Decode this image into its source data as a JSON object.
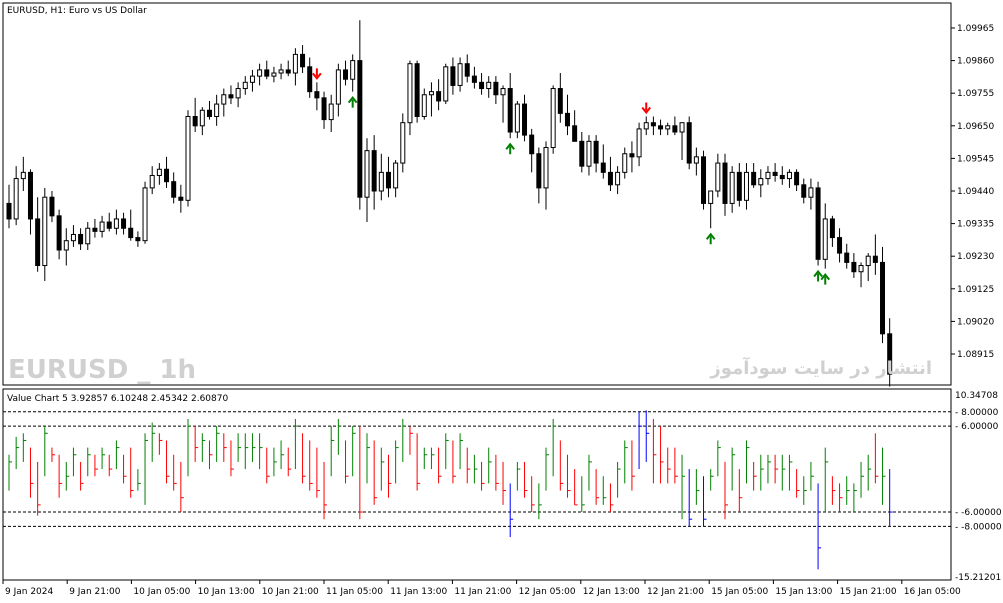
{
  "window": {
    "title": "EURUSD, H1:  Euro vs US Dollar",
    "watermark_left": "EURUSD _ 1h",
    "watermark_right": "انتشار در سایت سودآموز"
  },
  "indicator": {
    "title": "Value Chart 5 3.92857 6.10248 2.45342 2.60870",
    "levels": [
      8,
      6,
      -6,
      -8
    ],
    "level_labels": [
      "8.00000",
      "6.00000",
      "-6.00000",
      "-8.00000"
    ],
    "top_label": "10.34708",
    "bottom_label": "-15.21201",
    "colors": {
      "up": "#008000",
      "down": "#ff0000",
      "extreme": "#0000ff"
    }
  },
  "chart_data": {
    "type": "candlestick",
    "price_axis_labels": [
      "1.09965",
      "1.09860",
      "1.09755",
      "1.09650",
      "1.09545",
      "1.09440",
      "1.09335",
      "1.09230",
      "1.09125",
      "1.09020",
      "1.08915"
    ],
    "x_labels": [
      "9 Jan 2024",
      "9 Jan 21:00",
      "10 Jan 05:00",
      "10 Jan 13:00",
      "10 Jan 21:00",
      "11 Jan 05:00",
      "11 Jan 13:00",
      "11 Jan 21:00",
      "12 Jan 05:00",
      "12 Jan 13:00",
      "12 Jan 21:00",
      "15 Jan 05:00",
      "15 Jan 13:00",
      "15 Jan 21:00",
      "16 Jan 05:00"
    ],
    "ohlc": [
      [
        1.094,
        1.0946,
        1.0932,
        1.0935
      ],
      [
        1.0935,
        1.0952,
        1.0933,
        1.0948
      ],
      [
        1.0948,
        1.0955,
        1.0944,
        1.095
      ],
      [
        1.095,
        1.0951,
        1.093,
        1.0935
      ],
      [
        1.0935,
        1.0942,
        1.0918,
        1.092
      ],
      [
        1.092,
        1.0945,
        1.0915,
        1.0942
      ],
      [
        1.0942,
        1.0944,
        1.0934,
        1.0936
      ],
      [
        1.0936,
        1.0938,
        1.0922,
        1.0925
      ],
      [
        1.0925,
        1.0932,
        1.092,
        1.0928
      ],
      [
        1.0928,
        1.0933,
        1.0926,
        1.093
      ],
      [
        1.093,
        1.0932,
        1.0925,
        1.0927
      ],
      [
        1.0927,
        1.0934,
        1.0925,
        1.0932
      ],
      [
        1.0932,
        1.0935,
        1.0929,
        1.0931
      ],
      [
        1.0931,
        1.0936,
        1.0929,
        1.0934
      ],
      [
        1.0934,
        1.0937,
        1.0931,
        1.0932
      ],
      [
        1.0932,
        1.0938,
        1.093,
        1.0935
      ],
      [
        1.0935,
        1.0937,
        1.093,
        1.0932
      ],
      [
        1.0932,
        1.0938,
        1.0928,
        1.0929
      ],
      [
        1.0929,
        1.0931,
        1.0926,
        1.0928
      ],
      [
        1.0928,
        1.0947,
        1.0927,
        1.0945
      ],
      [
        1.0945,
        1.0952,
        1.0943,
        1.0949
      ],
      [
        1.0949,
        1.0953,
        1.0946,
        1.0951
      ],
      [
        1.0951,
        1.0955,
        1.0945,
        1.0947
      ],
      [
        1.0947,
        1.095,
        1.094,
        1.0942
      ],
      [
        1.0942,
        1.0946,
        1.0937,
        1.0941
      ],
      [
        1.0941,
        1.097,
        1.0939,
        1.0968
      ],
      [
        1.0968,
        1.0974,
        1.0963,
        1.0965
      ],
      [
        1.0965,
        1.0971,
        1.0962,
        1.097
      ],
      [
        1.097,
        1.0973,
        1.0967,
        1.0968
      ],
      [
        1.0968,
        1.0975,
        1.0965,
        1.0972
      ],
      [
        1.0972,
        1.0977,
        1.0968,
        1.0975
      ],
      [
        1.0975,
        1.0978,
        1.0972,
        1.0974
      ],
      [
        1.0974,
        1.0979,
        1.0971,
        1.0977
      ],
      [
        1.0977,
        1.0981,
        1.0975,
        1.0979
      ],
      [
        1.0979,
        1.0983,
        1.0976,
        1.0981
      ],
      [
        1.0981,
        1.0985,
        1.0978,
        1.0983
      ],
      [
        1.0983,
        1.0986,
        1.098,
        1.0981
      ],
      [
        1.0981,
        1.0984,
        1.0979,
        1.0982
      ],
      [
        1.0982,
        1.0985,
        1.098,
        1.0983
      ],
      [
        1.0983,
        1.0986,
        1.0981,
        1.0982
      ],
      [
        1.0982,
        1.099,
        1.0978,
        1.0988
      ],
      [
        1.0988,
        1.0991,
        1.0982,
        1.0984
      ],
      [
        1.0984,
        1.0987,
        1.0974,
        1.0976
      ],
      [
        1.0976,
        1.0979,
        1.097,
        1.0974
      ],
      [
        1.0974,
        1.0976,
        1.0964,
        1.0967
      ],
      [
        1.0967,
        1.0975,
        1.0963,
        1.0972
      ],
      [
        1.0972,
        1.0985,
        1.0968,
        1.0983
      ],
      [
        1.0983,
        1.0986,
        1.0978,
        1.098
      ],
      [
        1.098,
        1.0988,
        1.0976,
        1.0986
      ],
      [
        1.0986,
        1.0999,
        1.0938,
        1.0942
      ],
      [
        1.0942,
        1.0961,
        1.0934,
        1.0957
      ],
      [
        1.0957,
        1.0962,
        1.0938,
        1.0944
      ],
      [
        1.0944,
        1.0956,
        1.0941,
        1.095
      ],
      [
        1.095,
        1.0955,
        1.0942,
        1.0945
      ],
      [
        1.0945,
        1.0954,
        1.0942,
        1.0953
      ],
      [
        1.0953,
        1.0969,
        1.095,
        1.0966
      ],
      [
        1.0966,
        1.0986,
        1.0962,
        1.0985
      ],
      [
        1.0985,
        1.0986,
        1.0966,
        1.0968
      ],
      [
        1.0968,
        1.0977,
        1.0967,
        1.0975
      ],
      [
        1.0975,
        1.0979,
        1.0968,
        1.0976
      ],
      [
        1.0976,
        1.098,
        1.097,
        1.0973
      ],
      [
        1.0973,
        1.0985,
        1.0972,
        1.0984
      ],
      [
        1.0984,
        1.0987,
        1.0975,
        1.0978
      ],
      [
        1.0978,
        1.0987,
        1.0976,
        1.0985
      ],
      [
        1.0985,
        1.0988,
        1.0979,
        1.0981
      ],
      [
        1.0981,
        1.0984,
        1.0977,
        1.0979
      ],
      [
        1.0979,
        1.0982,
        1.0975,
        1.0977
      ],
      [
        1.0977,
        1.0981,
        1.0974,
        1.0979
      ],
      [
        1.0979,
        1.0981,
        1.0972,
        1.0975
      ],
      [
        1.0975,
        1.0978,
        1.0966,
        1.0977
      ],
      [
        1.0977,
        1.0982,
        1.0961,
        1.0963
      ],
      [
        1.0963,
        1.0973,
        1.0961,
        1.0972
      ],
      [
        1.0972,
        1.0975,
        1.096,
        1.0962
      ],
      [
        1.0962,
        1.0964,
        1.095,
        1.0956
      ],
      [
        1.0956,
        1.0958,
        1.094,
        1.0945
      ],
      [
        1.0945,
        1.096,
        1.0938,
        1.0958
      ],
      [
        1.0958,
        1.0978,
        1.0956,
        1.0977
      ],
      [
        1.0977,
        1.0982,
        1.0966,
        1.0969
      ],
      [
        1.0969,
        1.0975,
        1.0962,
        1.0965
      ],
      [
        1.0965,
        1.097,
        1.096,
        1.096
      ],
      [
        1.096,
        1.0963,
        1.095,
        1.0952
      ],
      [
        1.0952,
        1.0962,
        1.0949,
        1.096
      ],
      [
        1.096,
        1.0962,
        1.095,
        1.0953
      ],
      [
        1.0953,
        1.0959,
        1.0948,
        1.095
      ],
      [
        1.095,
        1.0955,
        1.0944,
        1.0946
      ],
      [
        1.0946,
        1.0952,
        1.0943,
        1.095
      ],
      [
        1.095,
        1.0958,
        1.0948,
        1.0956
      ],
      [
        1.0956,
        1.096,
        1.095,
        1.0955
      ],
      [
        1.0955,
        1.0966,
        1.0952,
        1.0964
      ],
      [
        1.0964,
        1.0968,
        1.0962,
        1.0966
      ],
      [
        1.0966,
        1.0968,
        1.0962,
        1.0965
      ],
      [
        1.0965,
        1.0967,
        1.0962,
        1.0964
      ],
      [
        1.0964,
        1.0966,
        1.0962,
        1.0965
      ],
      [
        1.0965,
        1.0968,
        1.0962,
        1.0963
      ],
      [
        1.0963,
        1.0966,
        1.0954,
        1.0966
      ],
      [
        1.0966,
        1.0968,
        1.0951,
        1.0953
      ],
      [
        1.0953,
        1.0958,
        1.0949,
        1.0955
      ],
      [
        1.0955,
        1.0957,
        1.0938,
        1.094
      ],
      [
        1.094,
        1.0944,
        1.0932,
        1.0944
      ],
      [
        1.0944,
        1.0956,
        1.0942,
        1.0953
      ],
      [
        1.0953,
        1.0956,
        1.0936,
        1.094
      ],
      [
        1.094,
        1.0952,
        1.0937,
        1.095
      ],
      [
        1.095,
        1.0953,
        1.0939,
        1.0941
      ],
      [
        1.0941,
        1.0953,
        1.0938,
        1.095
      ],
      [
        1.095,
        1.0953,
        1.0945,
        1.0946
      ],
      [
        1.0946,
        1.0951,
        1.0942,
        1.0948
      ],
      [
        1.0948,
        1.0952,
        1.0946,
        1.095
      ],
      [
        1.095,
        1.0953,
        1.0947,
        1.0949
      ],
      [
        1.0949,
        1.0952,
        1.0946,
        1.0948
      ],
      [
        1.0948,
        1.0951,
        1.0945,
        1.095
      ],
      [
        1.095,
        1.0951,
        1.0944,
        1.0946
      ],
      [
        1.0946,
        1.0948,
        1.094,
        1.0942
      ],
      [
        1.0942,
        1.0948,
        1.0938,
        1.0945
      ],
      [
        1.0945,
        1.0947,
        1.092,
        1.0922
      ],
      [
        1.0922,
        1.094,
        1.0919,
        1.0935
      ],
      [
        1.0935,
        1.0936,
        1.0926,
        1.0929
      ],
      [
        1.0929,
        1.0932,
        1.0921,
        1.0924
      ],
      [
        1.0924,
        1.0927,
        1.0919,
        1.0921
      ],
      [
        1.0921,
        1.0924,
        1.0916,
        1.0918
      ],
      [
        1.0918,
        1.0921,
        1.0913,
        1.092
      ],
      [
        1.092,
        1.0924,
        1.0915,
        1.0923
      ],
      [
        1.0923,
        1.093,
        1.0917,
        1.0921
      ],
      [
        1.0921,
        1.0926,
        1.0895,
        1.0898
      ],
      [
        1.0898,
        1.0903,
        1.0881,
        1.0885
      ]
    ],
    "value_chart": [
      [
        -3,
        2,
        1
      ],
      [
        0,
        4.5,
        3
      ],
      [
        1,
        5,
        4
      ],
      [
        -4,
        3,
        -2
      ],
      [
        -6.5,
        1,
        -5
      ],
      [
        -1,
        6,
        5
      ],
      [
        1,
        3,
        2
      ],
      [
        -4,
        2,
        -2
      ],
      [
        -3,
        1,
        -1
      ],
      [
        -1,
        3,
        2
      ],
      [
        -3,
        1,
        -2
      ],
      [
        -1,
        3,
        2
      ],
      [
        -1,
        2,
        0
      ],
      [
        0,
        3,
        2
      ],
      [
        -1,
        2,
        0
      ],
      [
        0,
        4,
        3
      ],
      [
        -2,
        2,
        -1
      ],
      [
        -4,
        3,
        -3
      ],
      [
        -3,
        0,
        -2
      ],
      [
        -5,
        5,
        4
      ],
      [
        1,
        6.5,
        5
      ],
      [
        2,
        5,
        4
      ],
      [
        -2,
        4,
        -1
      ],
      [
        -3,
        2,
        -2
      ],
      [
        -6,
        1,
        -4
      ],
      [
        -1,
        7,
        6
      ],
      [
        1,
        6,
        3
      ],
      [
        1,
        5,
        4
      ],
      [
        0,
        4,
        2
      ],
      [
        1,
        6,
        5
      ],
      [
        1,
        5,
        3
      ],
      [
        -1,
        4,
        0
      ],
      [
        1,
        5,
        3
      ],
      [
        0,
        5,
        3
      ],
      [
        1,
        5,
        3
      ],
      [
        0,
        5,
        3
      ],
      [
        -2,
        3,
        -1
      ],
      [
        -1,
        3,
        1
      ],
      [
        0,
        4,
        2
      ],
      [
        -1,
        3,
        0
      ],
      [
        0,
        7,
        6
      ],
      [
        -2,
        5,
        -1
      ],
      [
        -3,
        4,
        -2
      ],
      [
        -4,
        3,
        -3
      ],
      [
        -7,
        1,
        -5
      ],
      [
        -1,
        6,
        4
      ],
      [
        2,
        7,
        6
      ],
      [
        -2,
        4,
        -1
      ],
      [
        -1,
        6,
        5
      ],
      [
        -7,
        6,
        -6
      ],
      [
        -2,
        5,
        3
      ],
      [
        -5,
        4,
        -4
      ],
      [
        -3,
        3,
        1
      ],
      [
        -4,
        2,
        -2
      ],
      [
        -2,
        4,
        3
      ],
      [
        1,
        7,
        6
      ],
      [
        2,
        6,
        5
      ],
      [
        -3,
        5,
        -2
      ],
      [
        0,
        3,
        2
      ],
      [
        0,
        3,
        2
      ],
      [
        -2,
        3,
        -1
      ],
      [
        0,
        5,
        4
      ],
      [
        -2,
        4,
        -1
      ],
      [
        0,
        5,
        4
      ],
      [
        -2,
        3,
        0
      ],
      [
        -2,
        2,
        0
      ],
      [
        -3,
        1,
        -2
      ],
      [
        -2,
        3,
        1
      ],
      [
        -3,
        2,
        -2
      ],
      [
        -5,
        1,
        -3
      ],
      [
        -9.5,
        -2,
        -7
      ],
      [
        -3,
        1,
        0
      ],
      [
        -4,
        1,
        -3
      ],
      [
        -6,
        -1,
        -5
      ],
      [
        -7,
        -2,
        -5
      ],
      [
        -3,
        3,
        2
      ],
      [
        -1,
        7,
        6
      ],
      [
        -3,
        4,
        -2
      ],
      [
        -4,
        2,
        -3
      ],
      [
        -5,
        0,
        -5
      ],
      [
        -6,
        -1,
        -5
      ],
      [
        -3,
        2,
        1
      ],
      [
        -5,
        0,
        -4
      ],
      [
        -5,
        -1,
        -4
      ],
      [
        -6,
        -2,
        -5
      ],
      [
        -4,
        1,
        0
      ],
      [
        -2,
        4,
        3
      ],
      [
        -3,
        4,
        -1
      ],
      [
        0,
        8,
        6
      ],
      [
        1,
        8.2,
        5
      ],
      [
        -2,
        7,
        2
      ],
      [
        -2,
        6,
        1
      ],
      [
        -2,
        3,
        0
      ],
      [
        -2,
        3,
        -1
      ],
      [
        -7,
        2,
        -1
      ],
      [
        -8,
        0,
        -7
      ],
      [
        -5,
        0,
        -3
      ],
      [
        -8,
        -1,
        -7
      ],
      [
        -3,
        0,
        -1
      ],
      [
        -1,
        4,
        3
      ],
      [
        -7,
        1,
        -5
      ],
      [
        -3,
        3,
        2
      ],
      [
        -6,
        0,
        -4
      ],
      [
        -2,
        4,
        3
      ],
      [
        -3,
        1,
        -1
      ],
      [
        -3,
        2,
        0
      ],
      [
        -2,
        2,
        1
      ],
      [
        -2,
        2,
        0
      ],
      [
        -3,
        2,
        0
      ],
      [
        -3,
        2,
        1
      ],
      [
        -4,
        0,
        -3
      ],
      [
        -5,
        -1,
        -3
      ],
      [
        -3,
        1,
        -1
      ],
      [
        -14,
        -2,
        -11
      ],
      [
        -6,
        3,
        1
      ],
      [
        -5,
        -1,
        -3
      ],
      [
        -6,
        -2,
        -4
      ],
      [
        -5,
        -1,
        -3
      ],
      [
        -6,
        -2,
        -3
      ],
      [
        -4,
        1,
        -1
      ],
      [
        -3,
        2,
        0
      ],
      [
        -2,
        5,
        -1
      ],
      [
        -5,
        3,
        -1
      ],
      [
        -8,
        0,
        -6
      ]
    ],
    "arrows": [
      {
        "type": "down",
        "bar": 43
      },
      {
        "type": "up",
        "bar": 48
      },
      {
        "type": "up",
        "bar": 70
      },
      {
        "type": "down",
        "bar": 89
      },
      {
        "type": "up",
        "bar": 98
      },
      {
        "type": "up",
        "bar": 113
      },
      {
        "type": "up",
        "bar": 114
      }
    ]
  }
}
